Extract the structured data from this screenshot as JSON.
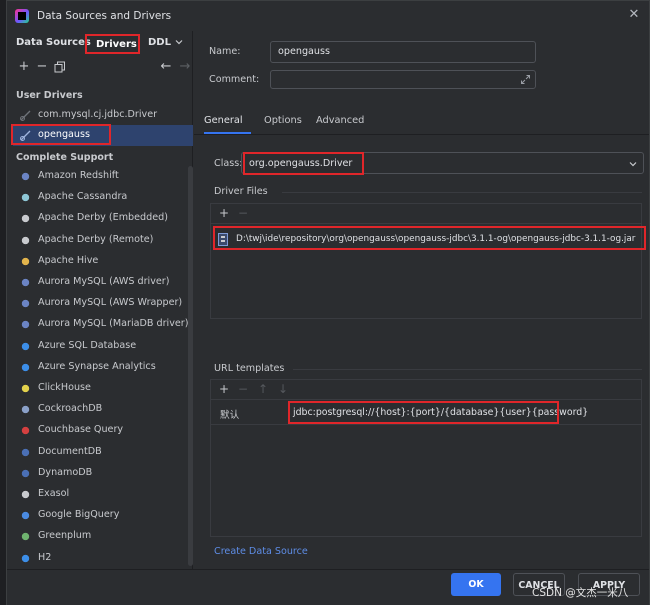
{
  "window": {
    "title": "Data Sources and Drivers"
  },
  "left": {
    "tabs": [
      "Data Sources",
      "Drivers",
      "DDL"
    ],
    "sections": {
      "user_drivers": "User Drivers",
      "complete_support": "Complete Support"
    },
    "user_drivers": [
      "com.mysql.cj.jdbc.Driver",
      "opengauss"
    ],
    "complete_support": [
      "Amazon Redshift",
      "Apache Cassandra",
      "Apache Derby (Embedded)",
      "Apache Derby (Remote)",
      "Apache Hive",
      "Aurora MySQL (AWS driver)",
      "Aurora MySQL (AWS Wrapper)",
      "Aurora MySQL (MariaDB driver)",
      "Azure SQL Database",
      "Azure Synapse Analytics",
      "ClickHouse",
      "CockroachDB",
      "Couchbase Query",
      "DocumentDB",
      "DynamoDB",
      "Exasol",
      "Google BigQuery",
      "Greenplum",
      "H2"
    ]
  },
  "right": {
    "name_label": "Name:",
    "name_value": "opengauss",
    "comment_label": "Comment:",
    "subtabs": [
      "General",
      "Options",
      "Advanced"
    ],
    "class_label": "Class:",
    "class_value": "org.opengauss.Driver",
    "driver_files_label": "Driver Files",
    "driver_file": "D:\\twj\\ide\\repository\\org\\opengauss\\opengauss-jdbc\\3.1.1-og\\opengauss-jdbc-3.1.1-og.jar",
    "url_templates_label": "URL templates",
    "url_row_name": "默认",
    "url_row_value": "jdbc:postgresql://{host}:{port}/{database}{user}{password}",
    "create_link": "Create Data Source"
  },
  "footer": {
    "ok": "OK",
    "cancel": "CANCEL",
    "apply": "APPLY"
  },
  "watermark": "CSDN @文杰一米八",
  "colors": {
    "accent": "#3574f0",
    "highlight": "#e0262a",
    "selection": "#2e436e",
    "link": "#5e8de6"
  }
}
